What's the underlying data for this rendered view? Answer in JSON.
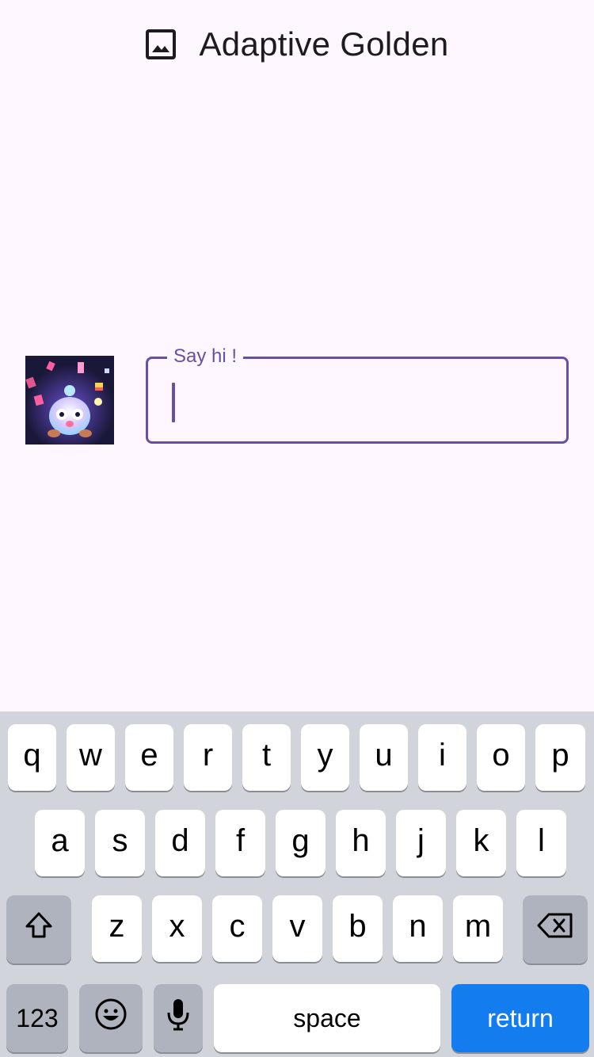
{
  "app_bar": {
    "icon": "image-icon",
    "title": "Adaptive Golden"
  },
  "main": {
    "avatar": "character-image",
    "input": {
      "label": "Say hi !",
      "value": "",
      "placeholder": ""
    }
  },
  "keyboard": {
    "row1": [
      "q",
      "w",
      "e",
      "r",
      "t",
      "y",
      "u",
      "i",
      "o",
      "p"
    ],
    "row2": [
      "a",
      "s",
      "d",
      "f",
      "g",
      "h",
      "j",
      "k",
      "l"
    ],
    "row3": [
      "z",
      "x",
      "c",
      "v",
      "b",
      "n",
      "m"
    ],
    "shift_icon": "shift-icon",
    "delete_icon": "backspace-icon",
    "numbers_label": "123",
    "emoji_icon": "emoji-icon",
    "mic_icon": "microphone-icon",
    "space_label": "space",
    "return_label": "return"
  },
  "colors": {
    "background": "#FEF7FF",
    "accent": "#6750A4",
    "keyboard_bg": "#D1D4DB",
    "return_key": "#137DF0"
  }
}
